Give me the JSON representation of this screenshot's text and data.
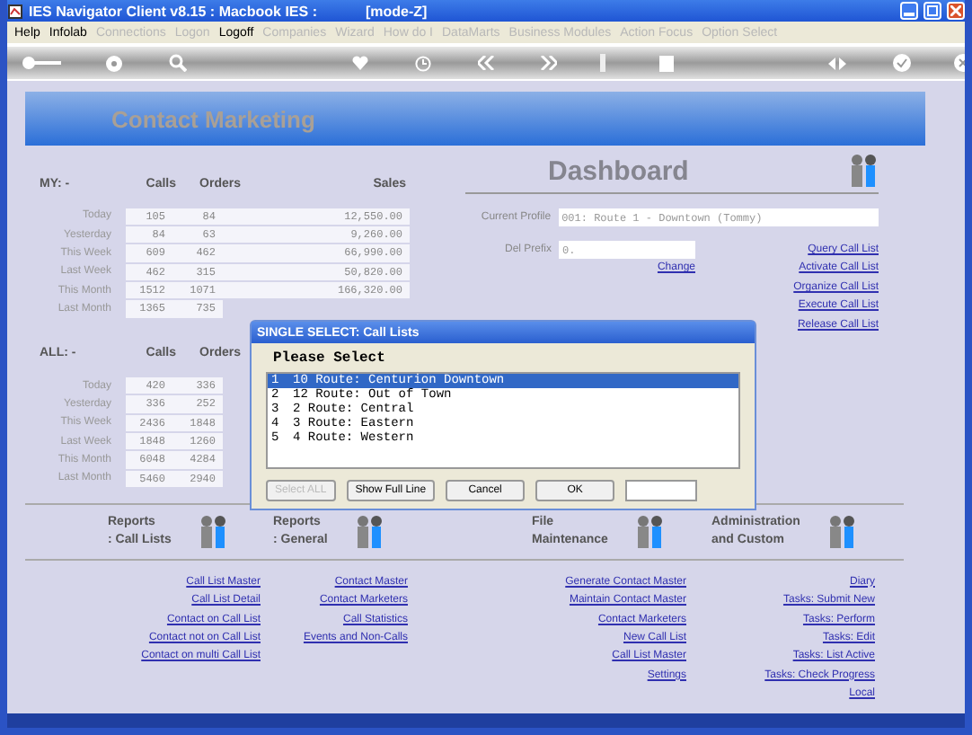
{
  "window": {
    "title": "IES Navigator Client v8.15 : Macbook IES :",
    "mode": "[mode-Z]"
  },
  "menu": [
    {
      "label": "Help",
      "disabled": false
    },
    {
      "label": "Infolab",
      "disabled": false
    },
    {
      "label": "Connections",
      "disabled": true
    },
    {
      "label": "Logon",
      "disabled": true
    },
    {
      "label": "Logoff",
      "disabled": false
    },
    {
      "label": "Companies",
      "disabled": true
    },
    {
      "label": "Wizard",
      "disabled": true
    },
    {
      "label": "How do I",
      "disabled": true
    },
    {
      "label": "DataMarts",
      "disabled": true
    },
    {
      "label": "Business Modules",
      "disabled": true
    },
    {
      "label": "Action Focus",
      "disabled": true
    },
    {
      "label": "Option Select",
      "disabled": true
    }
  ],
  "banner": {
    "title": "Contact Marketing"
  },
  "my": {
    "label": "MY: -",
    "columns": [
      "Calls",
      "Orders",
      "Sales"
    ],
    "rows": [
      {
        "period": "Today",
        "calls": "105",
        "orders": "84",
        "sales": "12,550.00"
      },
      {
        "period": "Yesterday",
        "calls": "84",
        "orders": "63",
        "sales": "9,260.00"
      },
      {
        "period": "This Week",
        "calls": "609",
        "orders": "462",
        "sales": "66,990.00"
      },
      {
        "period": "Last Week",
        "calls": "462",
        "orders": "315",
        "sales": "50,820.00"
      },
      {
        "period": "This Month",
        "calls": "1512",
        "orders": "1071",
        "sales": "166,320.00"
      },
      {
        "period": "Last Month",
        "calls": "1365",
        "orders": "735"
      }
    ]
  },
  "all": {
    "label": "ALL: -",
    "columns": [
      "Calls",
      "Orders"
    ],
    "rows": [
      {
        "period": "Today",
        "calls": "420",
        "orders": "336"
      },
      {
        "period": "Yesterday",
        "calls": "336",
        "orders": "252"
      },
      {
        "period": "This Week",
        "calls": "2436",
        "orders": "1848"
      },
      {
        "period": "Last Week",
        "calls": "1848",
        "orders": "1260"
      },
      {
        "period": "This Month",
        "calls": "6048",
        "orders": "4284"
      },
      {
        "period": "Last Month",
        "calls": "5460",
        "orders": "2940"
      }
    ]
  },
  "dashboard": {
    "title": "Dashboard",
    "profile_label": "Current Profile",
    "profile_value": "001: Route 1 - Downtown (Tommy)",
    "prefix_label": "Del Prefix",
    "prefix_value": "0.",
    "change_link": "Change",
    "links": [
      "Query Call List",
      "Activate Call List",
      "Organize Call List",
      "Execute Call List",
      "Release Call List"
    ]
  },
  "dialog": {
    "title": "SINGLE SELECT: Call Lists",
    "prompt": "Please Select",
    "items": [
      {
        "number": "1",
        "text": "10 Route: Centurion Downtown",
        "selected": true
      },
      {
        "number": "2",
        "text": "12 Route: Out of Town",
        "selected": false
      },
      {
        "number": "3",
        "text": "2 Route: Central",
        "selected": false
      },
      {
        "number": "4",
        "text": "3 Route: Eastern",
        "selected": false
      },
      {
        "number": "5",
        "text": "4 Route: Western",
        "selected": false
      }
    ],
    "buttons": [
      {
        "label": "Select ALL",
        "disabled": true
      },
      {
        "label": "Show Full Line",
        "disabled": false
      },
      {
        "label": "Cancel",
        "disabled": false
      },
      {
        "label": "OK",
        "disabled": false
      }
    ]
  },
  "sections": [
    {
      "title": [
        "Reports",
        ": Call Lists"
      ],
      "links": [
        "Call List Master",
        "Call List Detail",
        "Contact on Call List",
        "Contact not on Call List",
        "Contact on multi Call List"
      ]
    },
    {
      "title": [
        "Reports",
        ": General"
      ],
      "links": [
        "Contact Master",
        "Contact Marketers",
        "Call Statistics",
        "Events and Non-Calls"
      ]
    },
    {
      "title": [
        "File",
        "Maintenance"
      ],
      "links": [
        "Generate Contact Master",
        "Maintain Contact Master",
        "Contact Marketers",
        "New Call List",
        "Call List Master",
        "Settings"
      ]
    },
    {
      "title": [
        "Administration",
        "and Custom"
      ],
      "links": [
        "Diary",
        "Tasks: Submit New",
        "Tasks: Perform",
        "Tasks: Edit",
        "Tasks: List Active",
        "Tasks: Check Progress",
        "Local"
      ]
    }
  ]
}
